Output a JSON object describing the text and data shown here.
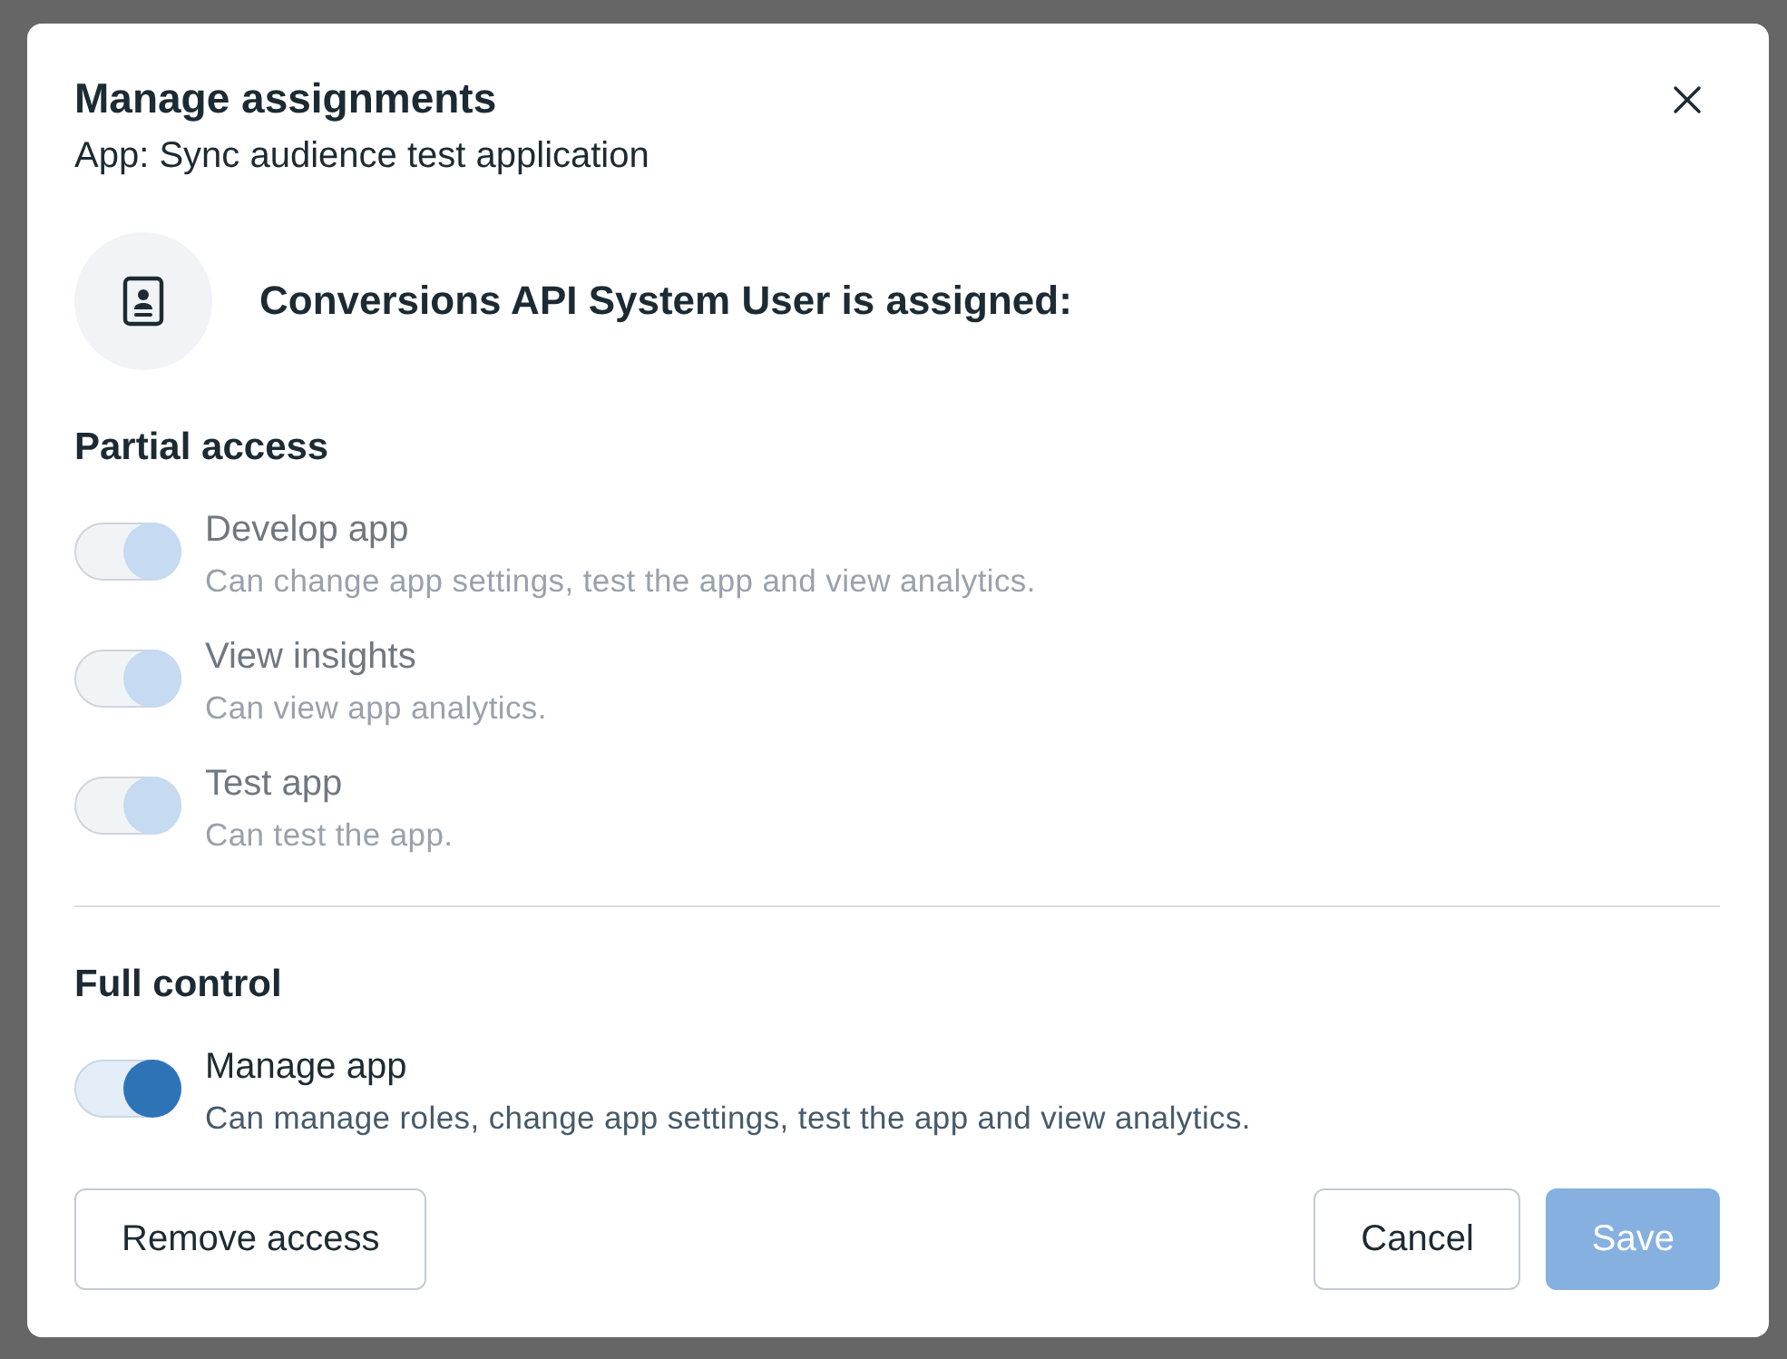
{
  "dialog": {
    "title": "Manage assignments",
    "subtitle": "App: Sync audience test application",
    "assignee": {
      "heading": "Conversions API System User is assigned:"
    },
    "sections": [
      {
        "title": "Partial access",
        "permissions": [
          {
            "label": "Develop app",
            "description": "Can change app settings, test the app and view analytics.",
            "on": true,
            "disabled": true
          },
          {
            "label": "View insights",
            "description": "Can view app analytics.",
            "on": true,
            "disabled": true
          },
          {
            "label": "Test app",
            "description": "Can test the app.",
            "on": true,
            "disabled": true
          }
        ]
      },
      {
        "title": "Full control",
        "permissions": [
          {
            "label": "Manage app",
            "description": "Can manage roles, change app settings, test the app and view analytics.",
            "on": true,
            "disabled": false
          }
        ]
      }
    ],
    "footer": {
      "start_buttons": [
        {
          "label": "Remove access",
          "kind": "secondary",
          "disabled": false
        }
      ],
      "end_buttons": [
        {
          "label": "Cancel",
          "kind": "secondary",
          "disabled": false
        },
        {
          "label": "Save",
          "kind": "primary",
          "disabled": true
        }
      ]
    }
  }
}
